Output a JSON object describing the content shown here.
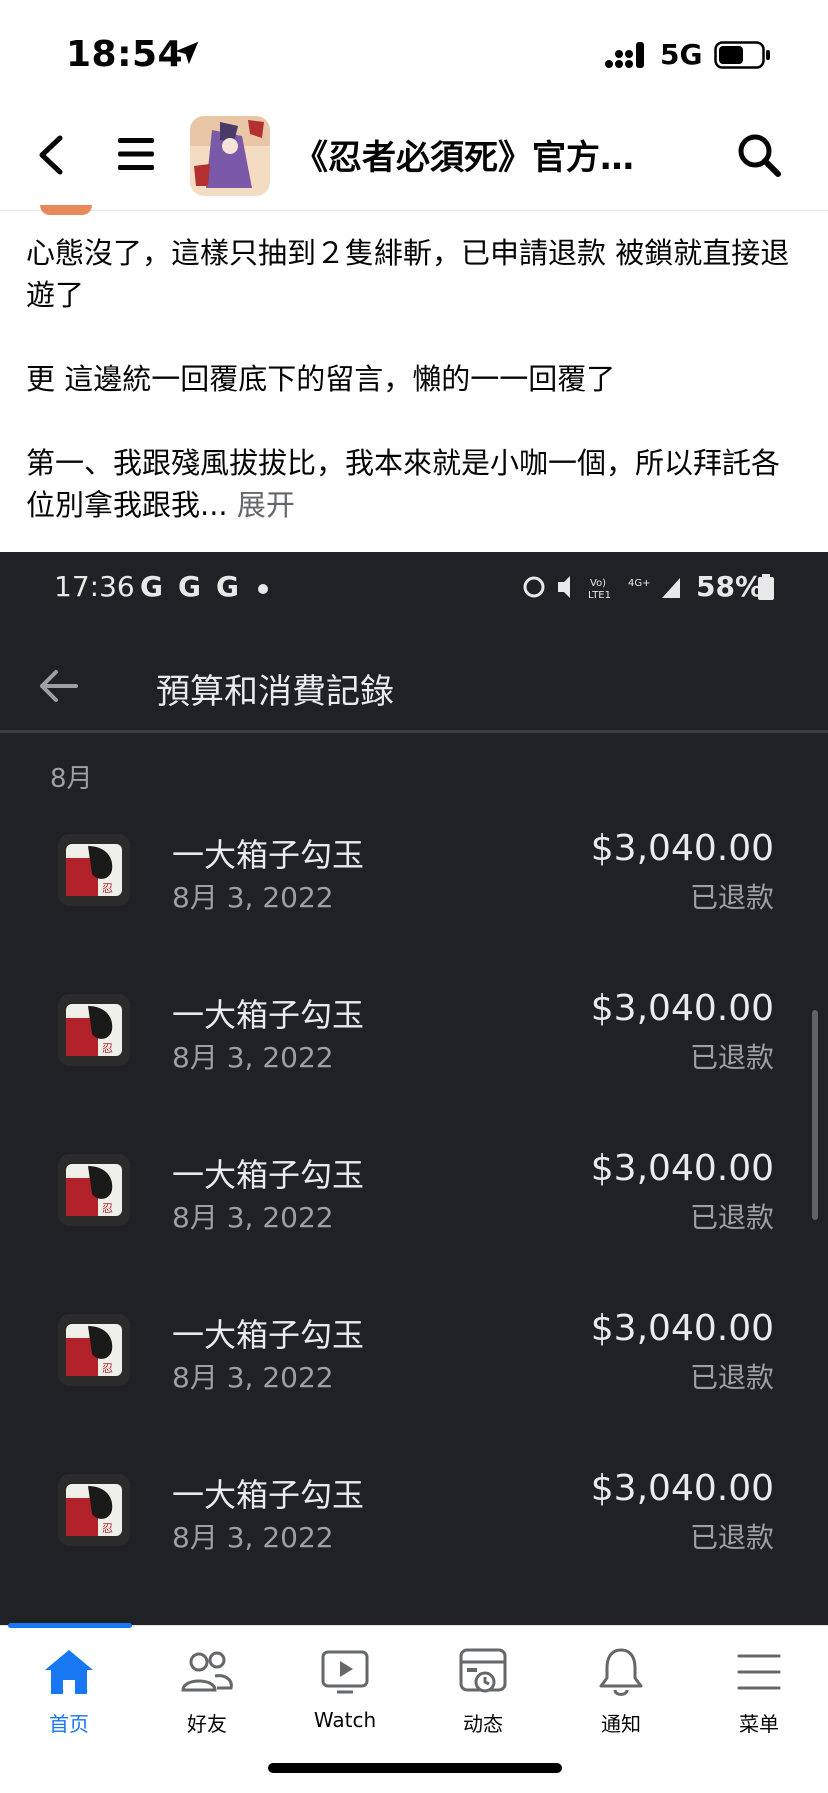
{
  "status_bar": {
    "time": "18:54",
    "network": "5G"
  },
  "nav": {
    "title": "《忍者必須死》官方…"
  },
  "post": {
    "paragraphs": [
      "心態沒了，這樣只抽到２隻緋斬，已申請退款  被鎖就直接退遊了",
      "更  這邊統一回覆底下的留言，懶的一一回覆了",
      "第一、我跟殘風拔拔比，我本來就是小咖一個，所以拜託各位別拿我跟我..."
    ],
    "see_more": "展开"
  },
  "screenshot": {
    "status_time": "17:36",
    "status_g": [
      "G",
      "G",
      "G"
    ],
    "battery": "58%",
    "title": "預算和消費記錄",
    "month": "8月",
    "transactions": [
      {
        "name": "一大箱子勾玉",
        "date": "8月 3, 2022",
        "amount": "$3,040.00",
        "status": "已退款"
      },
      {
        "name": "一大箱子勾玉",
        "date": "8月 3, 2022",
        "amount": "$3,040.00",
        "status": "已退款"
      },
      {
        "name": "一大箱子勾玉",
        "date": "8月 3, 2022",
        "amount": "$3,040.00",
        "status": "已退款"
      },
      {
        "name": "一大箱子勾玉",
        "date": "8月 3, 2022",
        "amount": "$3,040.00",
        "status": "已退款"
      },
      {
        "name": "一大箱子勾玉",
        "date": "8月 3, 2022",
        "amount": "$3,040.00",
        "status": "已退款"
      }
    ]
  },
  "tabs": [
    {
      "label": "首页",
      "icon": "home-icon",
      "active": true
    },
    {
      "label": "好友",
      "icon": "friends-icon",
      "active": false
    },
    {
      "label": "Watch",
      "icon": "watch-icon",
      "active": false
    },
    {
      "label": "动态",
      "icon": "feed-icon",
      "active": false
    },
    {
      "label": "通知",
      "icon": "bell-icon",
      "active": false
    },
    {
      "label": "菜单",
      "icon": "menu-icon",
      "active": false
    }
  ],
  "colors": {
    "accent": "#1877f2",
    "dark_bg": "#202124"
  }
}
